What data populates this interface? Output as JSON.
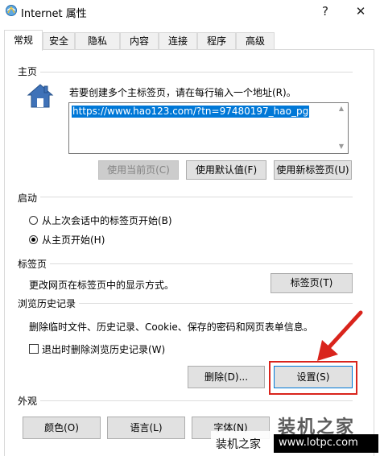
{
  "window": {
    "title": "Internet 属性",
    "help_glyph": "?",
    "close_glyph": "✕"
  },
  "tabs": [
    {
      "label": "常规"
    },
    {
      "label": "安全"
    },
    {
      "label": "隐私"
    },
    {
      "label": "内容"
    },
    {
      "label": "连接"
    },
    {
      "label": "程序"
    },
    {
      "label": "高级"
    }
  ],
  "home": {
    "header": "主页",
    "hint": "若要创建多个主标签页，请在每行输入一个地址(R)。",
    "url": "https://www.hao123.com/?tn=97480197_hao_pg",
    "btn_current": "使用当前页(C)",
    "btn_default": "使用默认值(F)",
    "btn_newtab": "使用新标签页(U)"
  },
  "startup": {
    "header": "启动",
    "opt_last_session": "从上次会话中的标签页开始(B)",
    "opt_home": "从主页开始(H)",
    "selected": "opt_home"
  },
  "tabs_section": {
    "header": "标签页",
    "desc": "更改网页在标签页中的显示方式。",
    "btn": "标签页(T)"
  },
  "history": {
    "header": "浏览历史记录",
    "desc": "删除临时文件、历史记录、Cookie、保存的密码和网页表单信息。",
    "checkbox_label": "退出时删除浏览历史记录(W)",
    "checkbox_checked": false,
    "btn_delete": "删除(D)...",
    "btn_settings": "设置(S)"
  },
  "appearance": {
    "header": "外观",
    "btn_colors": "颜色(O)",
    "btn_languages": "语言(L)",
    "btn_fonts": "字体(N)"
  },
  "watermark": {
    "big_text": "装机之家",
    "small_text": "装机之家",
    "url": "www.lotpc.com"
  },
  "colors": {
    "accent": "#0078d7",
    "annotation_red": "#d9241c"
  }
}
